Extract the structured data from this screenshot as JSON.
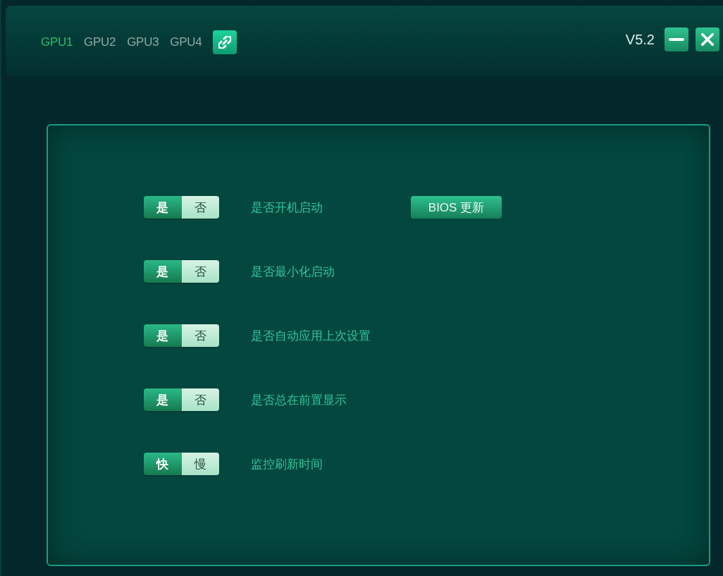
{
  "tabs": [
    {
      "label": "GPU1",
      "selected": true
    },
    {
      "label": "GPU2",
      "selected": false
    },
    {
      "label": "GPU3",
      "selected": false
    },
    {
      "label": "GPU4",
      "selected": false
    }
  ],
  "version": "V5.2",
  "settings": [
    {
      "options": [
        {
          "label": "是",
          "selected": true
        },
        {
          "label": "否",
          "selected": false
        }
      ],
      "label": "是否开机启动",
      "action": "BIOS 更新"
    },
    {
      "options": [
        {
          "label": "是",
          "selected": true
        },
        {
          "label": "否",
          "selected": false
        }
      ],
      "label": "是否最小化启动"
    },
    {
      "options": [
        {
          "label": "是",
          "selected": true
        },
        {
          "label": "否",
          "selected": false
        }
      ],
      "label": "是否自动应用上次设置"
    },
    {
      "options": [
        {
          "label": "是",
          "selected": true
        },
        {
          "label": "否",
          "selected": false
        }
      ],
      "label": "是否总在前置显示"
    },
    {
      "options": [
        {
          "label": "快",
          "selected": true
        },
        {
          "label": "慢",
          "selected": false
        }
      ],
      "label": "监控刷新时间"
    }
  ]
}
